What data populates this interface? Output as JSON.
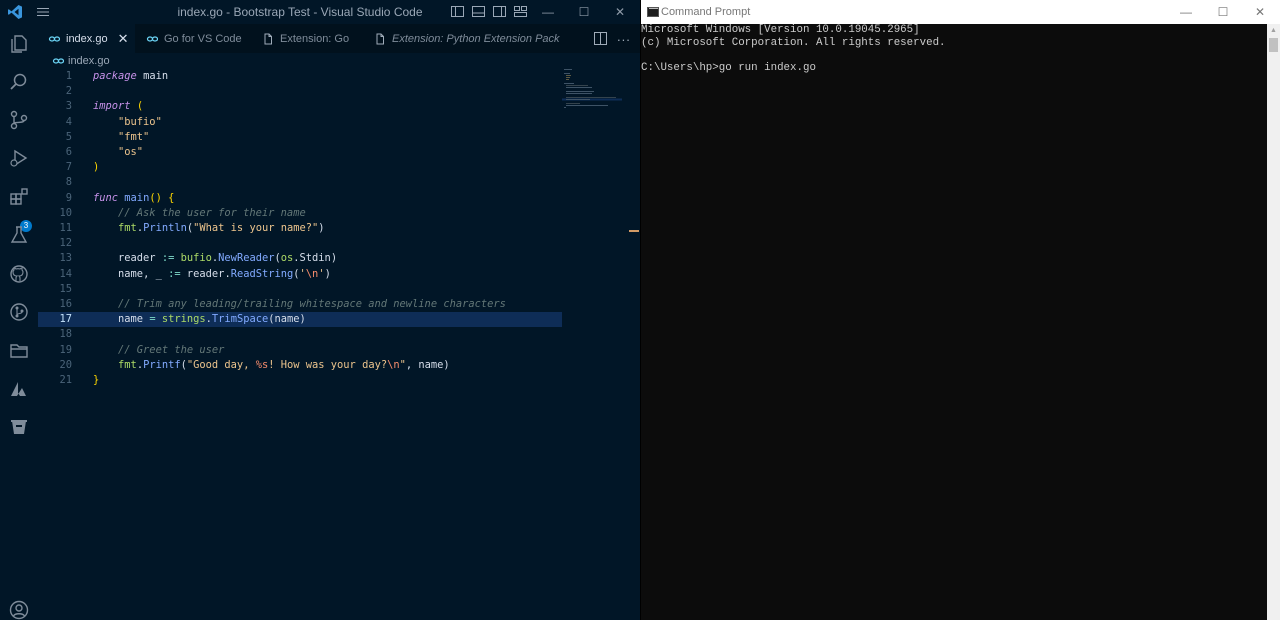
{
  "vscode": {
    "title": "index.go - Bootstrap Test - Visual Studio Code",
    "extensions_badge": "3",
    "tabs": [
      {
        "label": "index.go",
        "icon": "go-file-icon",
        "active": true,
        "italic": false
      },
      {
        "label": "Go for VS Code",
        "icon": "go-file-icon",
        "active": false,
        "italic": false
      },
      {
        "label": "Extension: Go",
        "icon": "file-icon",
        "active": false,
        "italic": false
      },
      {
        "label": "Extension: Python Extension Pack",
        "icon": "file-icon",
        "active": false,
        "italic": true
      }
    ],
    "tab_more": "...",
    "breadcrumb": "index.go",
    "current_line": 17,
    "lines": [
      "package main",
      "",
      "import (",
      "    \"bufio\"",
      "    \"fmt\"",
      "    \"os\"",
      ")",
      "",
      "func main() {",
      "    // Ask the user for their name",
      "    fmt.Println(\"What is your name?\")",
      "",
      "    reader := bufio.NewReader(os.Stdin)",
      "    name, _ := reader.ReadString('\\n')",
      "",
      "    // Trim any leading/trailing whitespace and newline characters",
      "    name = strings.TrimSpace(name)",
      "",
      "    // Greet the user",
      "    fmt.Printf(\"Good day, %s! How was your day?\\n\", name)",
      "}"
    ],
    "colors": {
      "background": "#011627",
      "keyword": "#c792ea",
      "function": "#82aaff",
      "string": "#ecc48d",
      "comment": "#637777",
      "current_line": "#0e2d57"
    }
  },
  "cmd": {
    "title": "Command Prompt",
    "lines": [
      "Microsoft Windows [Version 10.0.19045.2965]",
      "(c) Microsoft Corporation. All rights reserved.",
      "",
      "C:\\Users\\hp>go run index.go"
    ]
  }
}
